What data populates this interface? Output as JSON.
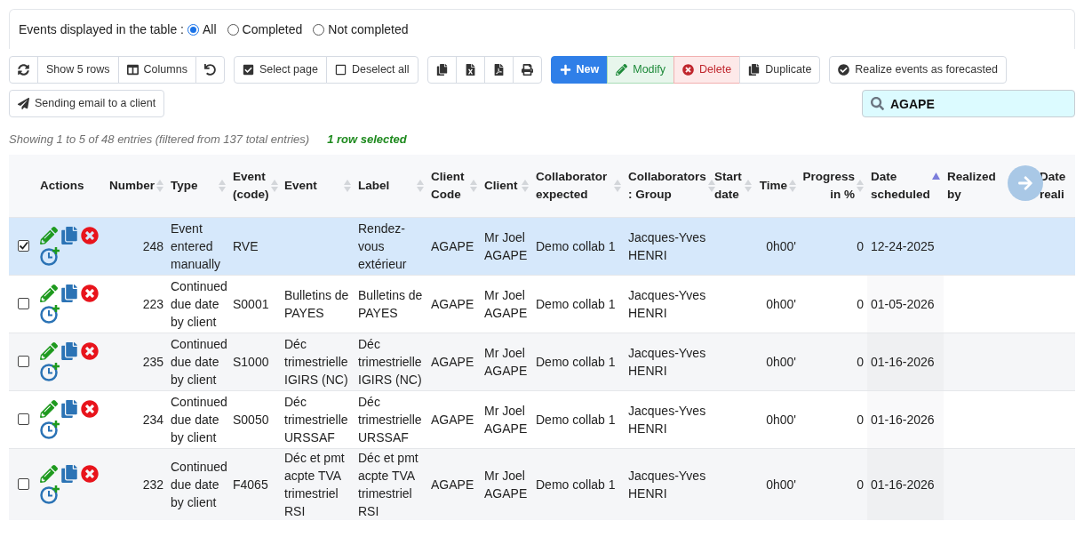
{
  "filter": {
    "label": "Events displayed in the table :",
    "options": [
      {
        "label": "All",
        "selected": true
      },
      {
        "label": "Completed",
        "selected": false
      },
      {
        "label": "Not completed",
        "selected": false
      }
    ]
  },
  "toolbar": {
    "groups": [
      [
        {
          "kind": "default"
        },
        {
          "label": "Show 5 rows",
          "kind": "default"
        },
        {
          "label": "Columns",
          "kind": "default"
        },
        {
          "kind": "default"
        }
      ],
      [
        {
          "label": "Select page",
          "kind": "default"
        },
        {
          "label": "Deselect all",
          "kind": "default"
        }
      ],
      [
        {
          "kind": "default"
        },
        {
          "kind": "default"
        },
        {
          "kind": "default"
        },
        {
          "kind": "default"
        }
      ],
      [
        {
          "label": "New",
          "kind": "primary"
        },
        {
          "label": "Modify",
          "kind": "success"
        },
        {
          "label": "Delete",
          "kind": "danger"
        },
        {
          "label": "Duplicate",
          "kind": "default"
        }
      ],
      [
        {
          "label": "Realize events as forecasted",
          "kind": "default"
        }
      ],
      [
        {
          "label": "Sending email to a client",
          "kind": "default"
        }
      ]
    ]
  },
  "search": {
    "value": "AGAPE"
  },
  "info": {
    "text": "Showing 1 to 5 of 48 entries (filtered from 137 total entries)",
    "selection": "1 row selected"
  },
  "table": {
    "columns": [
      {
        "label": "Actions",
        "sorted": false
      },
      {
        "label": "Number",
        "sorted": false
      },
      {
        "label": "Type",
        "sorted": false
      },
      {
        "label": "Event (code)",
        "sorted": false
      },
      {
        "label": "Event",
        "sorted": false
      },
      {
        "label": "Label",
        "sorted": false
      },
      {
        "label": "Client Code",
        "sorted": false
      },
      {
        "label": "Client",
        "sorted": false
      },
      {
        "label": "Collaborator expected",
        "sorted": false
      },
      {
        "label": "Collaborators : Group",
        "sorted": false
      },
      {
        "label": "Start date",
        "sorted": false
      },
      {
        "label": "Time",
        "sorted": false
      },
      {
        "label": "Progress in %",
        "sorted": false
      },
      {
        "label": "Date scheduled",
        "sorted": true
      },
      {
        "label": "Realized by",
        "sorted": false
      },
      {
        "label": "Date reali",
        "sorted": false
      }
    ],
    "rows": [
      {
        "selected": true,
        "cells": [
          "",
          "248",
          "Event entered manually",
          "RVE",
          "",
          "Rendez-vous extérieur",
          "AGAPE",
          "Mr Joel AGAPE",
          "Demo collab 1",
          "Jacques-Yves HENRI",
          "",
          "0h00'",
          "0",
          "12-24-2025",
          "",
          ""
        ]
      },
      {
        "selected": false,
        "cells": [
          "",
          "223",
          "Continued due date by client",
          "S0001",
          "Bulletins de PAYES",
          "Bulletins de PAYES",
          "AGAPE",
          "Mr Joel AGAPE",
          "Demo collab 1",
          "Jacques-Yves HENRI",
          "",
          "0h00'",
          "0",
          "01-05-2026",
          "",
          ""
        ]
      },
      {
        "selected": false,
        "cells": [
          "",
          "235",
          "Continued due date by client",
          "S1000",
          "Déc trimestrielle IGIRS (NC)",
          "Déc trimestrielle IGIRS (NC)",
          "AGAPE",
          "Mr Joel AGAPE",
          "Demo collab 1",
          "Jacques-Yves HENRI",
          "",
          "0h00'",
          "0",
          "01-16-2026",
          "",
          ""
        ]
      },
      {
        "selected": false,
        "cells": [
          "",
          "234",
          "Continued due date by client",
          "S0050",
          "Déc trimestrielle URSSAF",
          "Déc trimestrielle URSSAF",
          "AGAPE",
          "Mr Joel AGAPE",
          "Demo collab 1",
          "Jacques-Yves HENRI",
          "",
          "0h00'",
          "0",
          "01-16-2026",
          "",
          ""
        ]
      },
      {
        "selected": false,
        "cells": [
          "",
          "232",
          "Continued due date by client",
          "F4065",
          "Déc et pmt acpte TVA trimestriel RSI",
          "Déc et pmt acpte TVA trimestriel RSI",
          "AGAPE",
          "Mr Joel AGAPE",
          "Demo collab 1",
          "Jacques-Yves HENRI",
          "",
          "0h00'",
          "0",
          "01-16-2026",
          "",
          ""
        ]
      }
    ]
  }
}
